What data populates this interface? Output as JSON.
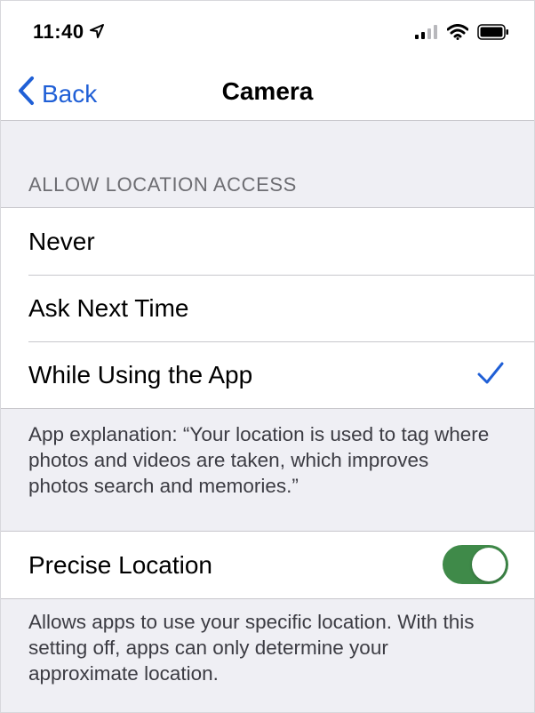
{
  "status_bar": {
    "time": "11:40"
  },
  "nav": {
    "back_label": "Back",
    "title": "Camera"
  },
  "location_section": {
    "header": "ALLOW LOCATION ACCESS",
    "options": [
      {
        "label": "Never",
        "selected": false
      },
      {
        "label": "Ask Next Time",
        "selected": false
      },
      {
        "label": "While Using the App",
        "selected": true
      }
    ],
    "explanation": "App explanation: “Your location is used to tag where photos and videos are taken, which improves photos search and memories.”"
  },
  "precise_section": {
    "label": "Precise Location",
    "enabled": true,
    "footer": "Allows apps to use your specific location. With this setting off, apps can only determine your approximate location."
  },
  "colors": {
    "accent": "#1f5fd6",
    "toggle_on": "#3f8a49",
    "background": "#efeff4"
  },
  "icons": [
    "location-arrow-icon",
    "cellular-signal-icon",
    "wifi-icon",
    "battery-icon",
    "chevron-left-icon",
    "checkmark-icon"
  ]
}
